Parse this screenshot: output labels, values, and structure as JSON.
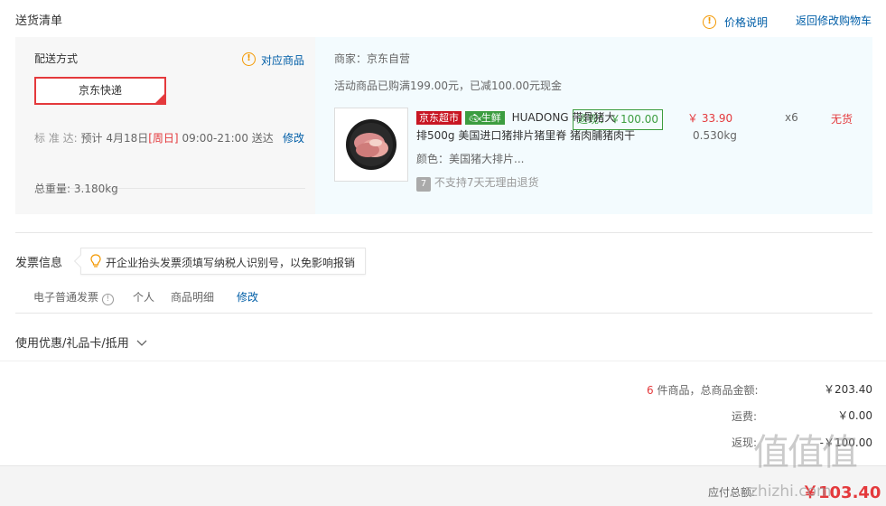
{
  "header": {
    "title": "送货清单",
    "price_note": "价格说明",
    "back_cart": "返回修改购物车"
  },
  "delivery": {
    "method_label": "配送方式",
    "match_goods": "对应商品",
    "method_selected": "京东快递",
    "standard_label": "标 准 达:",
    "standard_value": "预计 4月18日",
    "standard_weekday": "[周日]",
    "standard_time": "09:00-21:00 送达",
    "modify": "修改",
    "weight_label": "总重量:",
    "weight_value": "3.180kg"
  },
  "order": {
    "merchant": "商家：京东自营",
    "promo": "活动商品已购满199.00元，已减100.00元现金",
    "rebate": "返现：￥100.00",
    "item": {
      "tag_jd": "京东超市",
      "tag_fresh": "生鲜",
      "name_line1": "HUADONG 带骨猪大",
      "name_line2": "排500g 美国进口猪排片猪里脊 猪肉脯猪肉干",
      "color": "颜色：美国猪大排片...",
      "no_return": "不支持7天无理由退货",
      "price": "￥ 33.90",
      "weight": "0.530kg",
      "qty": "x6",
      "stock": "无货"
    }
  },
  "invoice": {
    "title": "发票信息",
    "tip": "开企业抬头发票须填写纳税人识别号，以免影响报销",
    "type": "电子普通发票",
    "person": "个人",
    "detail": "商品明细",
    "modify": "修改"
  },
  "coupon": {
    "label": "使用优惠/礼品卡/抵用"
  },
  "summary": {
    "count": "6",
    "count_text": "件商品，总商品金额:",
    "total": "￥203.40",
    "freight_label": "运费:",
    "freight": "￥0.00",
    "rebate_label": "返现:",
    "rebate": "-￥100.00"
  },
  "pay": {
    "label": "应付总额:",
    "amount": "￥103.40"
  },
  "watermark": {
    "brand": "值",
    "site": "zhizhi.com"
  }
}
